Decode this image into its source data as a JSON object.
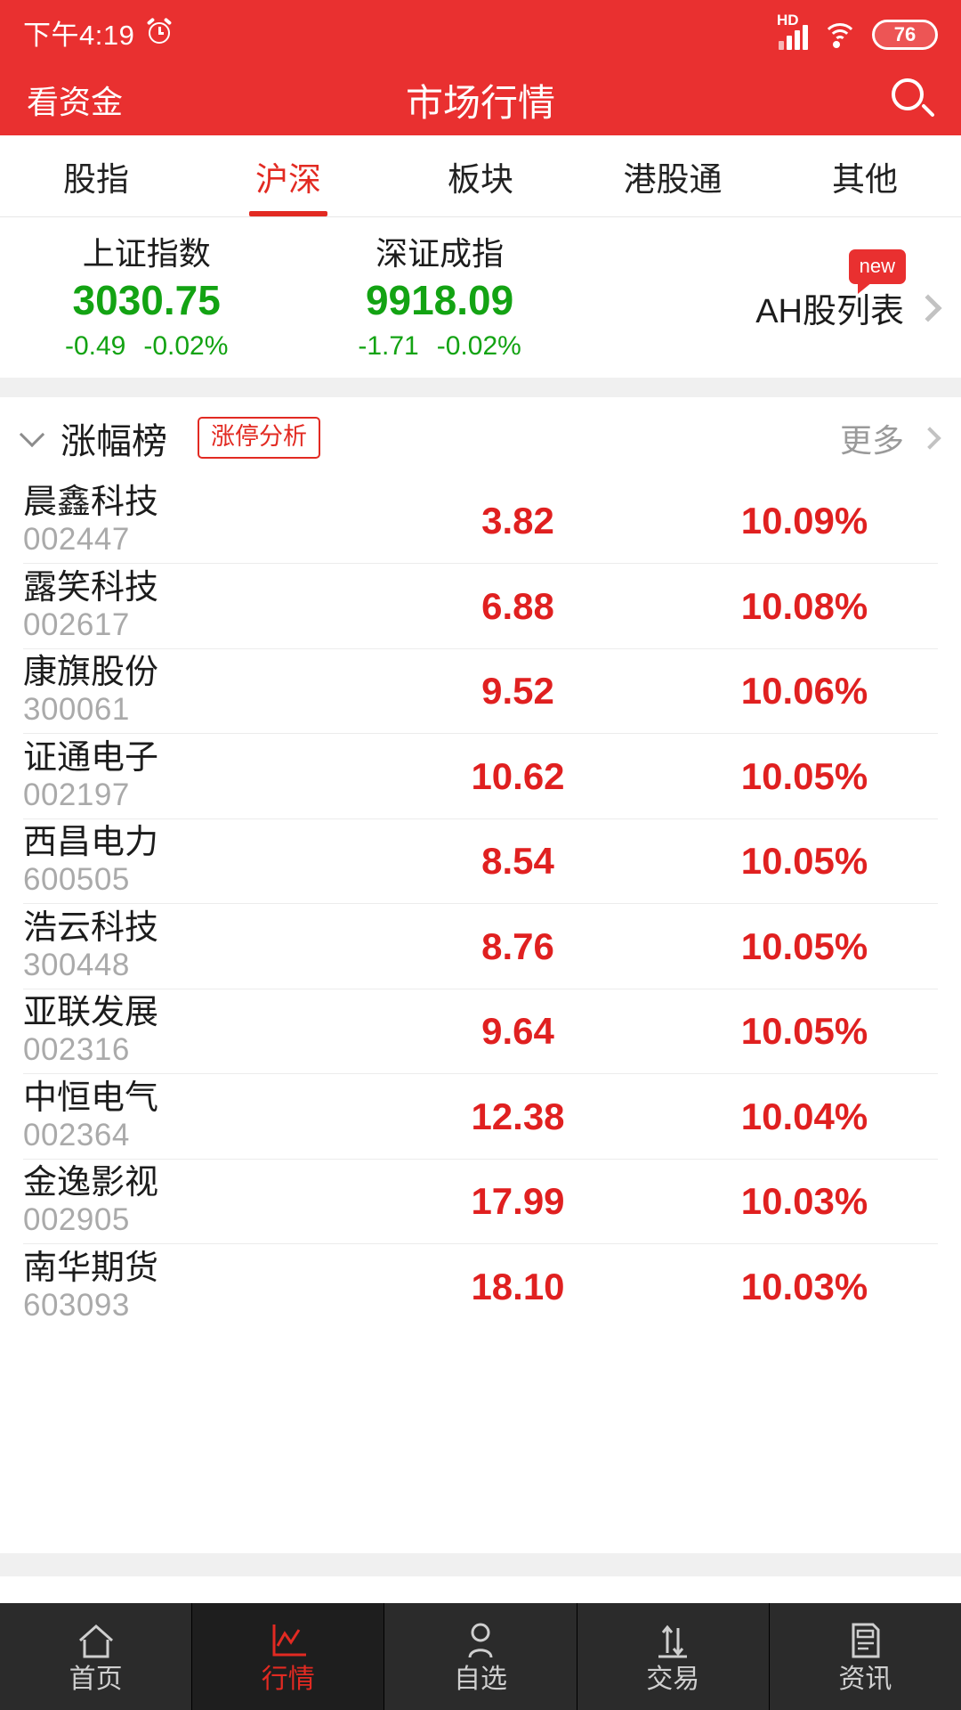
{
  "status_bar": {
    "time": "下午4:19",
    "alarm_icon": "alarm-clock-icon",
    "hd_label": "HD",
    "signal_icon": "signal-bars-icon",
    "wifi_icon": "wifi-icon",
    "battery_level": "76"
  },
  "header": {
    "left_action": "看资金",
    "title": "市场行情",
    "search_icon": "search-icon"
  },
  "tabs": [
    {
      "label": "股指",
      "active": false
    },
    {
      "label": "沪深",
      "active": true
    },
    {
      "label": "板块",
      "active": false
    },
    {
      "label": "港股通",
      "active": false
    },
    {
      "label": "其他",
      "active": false
    }
  ],
  "indices": [
    {
      "name": "上证指数",
      "value": "3030.75",
      "change": "-0.49",
      "change_pct": "-0.02%",
      "direction": "down"
    },
    {
      "name": "深证成指",
      "value": "9918.09",
      "change": "-1.71",
      "change_pct": "-0.02%",
      "direction": "down"
    }
  ],
  "ah_entry": {
    "label": "AH股列表",
    "badge": "new",
    "chevron_icon": "chevron-right-icon"
  },
  "list_header": {
    "caret_icon": "chevron-down-icon",
    "title": "涨幅榜",
    "chip": "涨停分析",
    "more": "更多",
    "more_chevron_icon": "chevron-right-icon"
  },
  "stocks": [
    {
      "name": "晨鑫科技",
      "code": "002447",
      "price": "3.82",
      "pct": "10.09%"
    },
    {
      "name": "露笑科技",
      "code": "002617",
      "price": "6.88",
      "pct": "10.08%"
    },
    {
      "name": "康旗股份",
      "code": "300061",
      "price": "9.52",
      "pct": "10.06%"
    },
    {
      "name": "证通电子",
      "code": "002197",
      "price": "10.62",
      "pct": "10.05%"
    },
    {
      "name": "西昌电力",
      "code": "600505",
      "price": "8.54",
      "pct": "10.05%"
    },
    {
      "name": "浩云科技",
      "code": "300448",
      "price": "8.76",
      "pct": "10.05%"
    },
    {
      "name": "亚联发展",
      "code": "002316",
      "price": "9.64",
      "pct": "10.05%"
    },
    {
      "name": "中恒电气",
      "code": "002364",
      "price": "12.38",
      "pct": "10.04%"
    },
    {
      "name": "金逸影视",
      "code": "002905",
      "price": "17.99",
      "pct": "10.03%"
    },
    {
      "name": "南华期货",
      "code": "603093",
      "price": "18.10",
      "pct": "10.03%"
    }
  ],
  "bottom_nav": [
    {
      "label": "首页",
      "icon": "home-icon",
      "active": false
    },
    {
      "label": "行情",
      "icon": "chart-icon",
      "active": true
    },
    {
      "label": "自选",
      "icon": "person-icon",
      "active": false
    },
    {
      "label": "交易",
      "icon": "transfer-icon",
      "active": false
    },
    {
      "label": "资讯",
      "icon": "news-icon",
      "active": false
    }
  ],
  "colors": {
    "brand_red": "#E93030",
    "up_red": "#E02020",
    "down_green": "#13A313",
    "nav_dark": "#2b2b2b",
    "band_gray": "#F0F0F0"
  }
}
